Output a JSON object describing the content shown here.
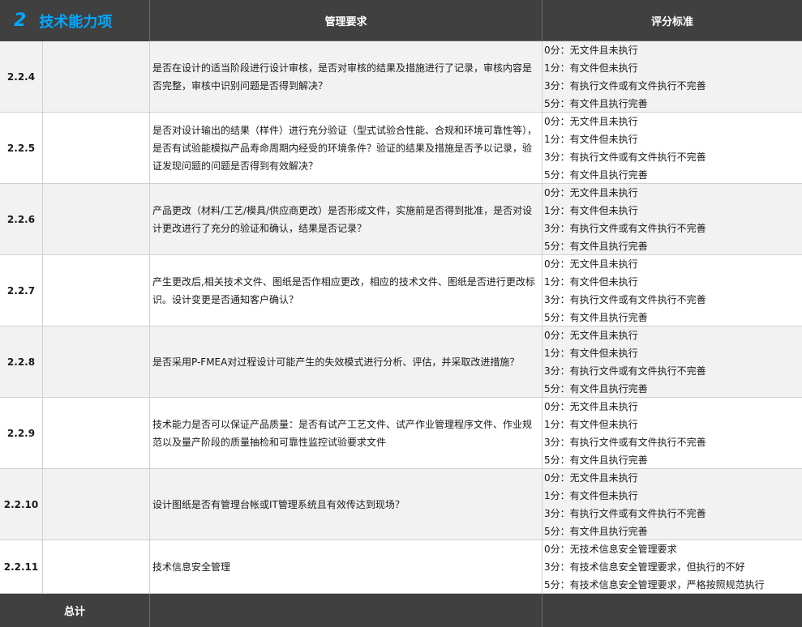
{
  "header": {
    "section_number": "2",
    "section_title": "技术能力项",
    "col_requirement": "管理要求",
    "col_scoring": "评分标准"
  },
  "rows": [
    {
      "id": "2.2.4",
      "requirement": "是否在设计的适当阶段进行设计审核，是否对审核的结果及措施进行了记录，审核内容是否完整，审核中识别问题是否得到解决？",
      "scores": [
        "0分：无文件且未执行",
        "1分：有文件但未执行",
        "3分：有执行文件或有文件执行不完善",
        "5分：有文件且执行完善"
      ]
    },
    {
      "id": "2.2.5",
      "requirement": "是否对设计输出的结果（样件）进行充分验证（型式试验合性能、合规和环境可靠性等），是否有试验能模拟产品寿命周期内经受的环境条件？验证的结果及措施是否予以记录，验证发现问题的问题是否得到有效解决？",
      "scores": [
        "0分：无文件且未执行",
        "1分：有文件但未执行",
        "3分：有执行文件或有文件执行不完善",
        "5分：有文件且执行完善"
      ]
    },
    {
      "id": "2.2.6",
      "requirement": "产品更改（材料/工艺/模具/供应商更改）是否形成文件，实施前是否得到批准，是否对设计更改进行了充分的验证和确认，结果是否记录？",
      "scores": [
        "0分：无文件且未执行",
        "1分：有文件但未执行",
        "3分：有执行文件或有文件执行不完善",
        "5分：有文件且执行完善"
      ]
    },
    {
      "id": "2.2.7",
      "requirement": "产生更改后,相关技术文件、图纸是否作相应更改，相应的技术文件、图纸是否进行更改标识。设计变更是否通知客户确认？",
      "scores": [
        "0分：无文件且未执行",
        "1分：有文件但未执行",
        "3分：有执行文件或有文件执行不完善",
        "5分：有文件且执行完善"
      ]
    },
    {
      "id": "2.2.8",
      "requirement": "是否采用P-FMEA对过程设计可能产生的失效模式进行分析、评估，并采取改进措施？",
      "scores": [
        "0分：无文件且未执行",
        "1分：有文件但未执行",
        "3分：有执行文件或有文件执行不完善",
        "5分：有文件且执行完善"
      ]
    },
    {
      "id": "2.2.9",
      "requirement": "技术能力是否可以保证产品质量：是否有试产工艺文件、试产作业管理程序文件、作业规范以及量产阶段的质量抽检和可靠性监控试验要求文件",
      "scores": [
        "0分：无文件且未执行",
        "1分：有文件但未执行",
        "3分：有执行文件或有文件执行不完善",
        "5分：有文件且执行完善"
      ]
    },
    {
      "id": "2.2.10",
      "requirement": "设计图纸是否有管理台帐或IT管理系统且有效传达到现场？",
      "scores": [
        "0分：无文件且未执行",
        "1分：有文件但未执行",
        "3分：有执行文件或有文件执行不完善",
        "5分：有文件且执行完善"
      ]
    },
    {
      "id": "2.2.11",
      "requirement": "技术信息安全管理",
      "scores": [
        "0分：无技术信息安全管理要求",
        "3分：有技术信息安全管理要求，但执行的不好",
        "5分：有技术信息安全管理要求，严格按照规范执行"
      ]
    }
  ],
  "footer": {
    "total_label": "总计"
  },
  "colors": {
    "header_bg": "#404040",
    "accent": "#00a8ff",
    "zebra": "#f2f2f2"
  }
}
